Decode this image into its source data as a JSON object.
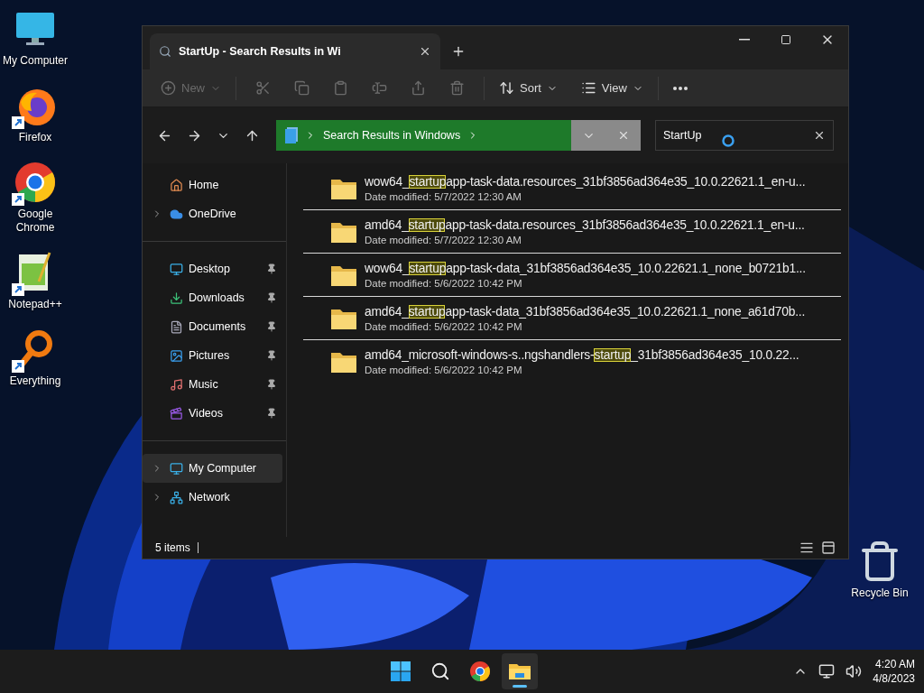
{
  "desktop_icons": [
    {
      "label": "My Computer",
      "shortcut": false
    },
    {
      "label": "Firefox",
      "shortcut": true
    },
    {
      "label": "Google Chrome",
      "shortcut": true
    },
    {
      "label": "Notepad++",
      "shortcut": true
    },
    {
      "label": "Everything",
      "shortcut": true
    }
  ],
  "recycle_bin": {
    "label": "Recycle Bin"
  },
  "window": {
    "tab": {
      "title": "StartUp - Search Results in Wi"
    },
    "toolbar": {
      "new": {
        "label": "New",
        "disabled": true
      },
      "actions": [
        {
          "disabled": true
        },
        {
          "disabled": true
        },
        {
          "disabled": true
        },
        {
          "disabled": true
        },
        {
          "disabled": true
        },
        {
          "disabled": true
        }
      ],
      "sort": {
        "label": "Sort"
      },
      "view": {
        "label": "View"
      }
    },
    "address": {
      "location": "Search Results in Windows"
    },
    "search": {
      "value": "StartUp"
    },
    "navigation": [
      {
        "items": [
          {
            "label": "Home",
            "expandable": false,
            "pinned": false,
            "selected": false
          },
          {
            "label": "OneDrive",
            "expandable": true,
            "pinned": false,
            "selected": false
          }
        ]
      },
      {
        "items": [
          {
            "label": "Desktop",
            "expandable": false,
            "pinned": true,
            "selected": false
          },
          {
            "label": "Downloads",
            "expandable": false,
            "pinned": true,
            "selected": false
          },
          {
            "label": "Documents",
            "expandable": false,
            "pinned": true,
            "selected": false
          },
          {
            "label": "Pictures",
            "expandable": false,
            "pinned": true,
            "selected": false
          },
          {
            "label": "Music",
            "expandable": false,
            "pinned": true,
            "selected": false
          },
          {
            "label": "Videos",
            "expandable": false,
            "pinned": true,
            "selected": false
          }
        ]
      },
      {
        "items": [
          {
            "label": "My Computer",
            "expandable": true,
            "pinned": false,
            "selected": true
          },
          {
            "label": "Network",
            "expandable": true,
            "pinned": false,
            "selected": false
          }
        ]
      }
    ],
    "files": [
      {
        "name": {
          "prefix": "wow64_",
          "match": "startup",
          "suffix": "app-task-data.resources_31bf3856ad364e35_10.0.22621.1_en-u..."
        },
        "modified": "Date modified: 5/7/2022 12:30 AM"
      },
      {
        "name": {
          "prefix": "amd64_",
          "match": "startup",
          "suffix": "app-task-data.resources_31bf3856ad364e35_10.0.22621.1_en-u..."
        },
        "modified": "Date modified: 5/7/2022 12:30 AM"
      },
      {
        "name": {
          "prefix": "wow64_",
          "match": "startup",
          "suffix": "app-task-data_31bf3856ad364e35_10.0.22621.1_none_b0721b1..."
        },
        "modified": "Date modified: 5/6/2022 10:42 PM"
      },
      {
        "name": {
          "prefix": "amd64_",
          "match": "startup",
          "suffix": "app-task-data_31bf3856ad364e35_10.0.22621.1_none_a61d70b..."
        },
        "modified": "Date modified: 5/6/2022 10:42 PM"
      },
      {
        "name": {
          "prefix": "amd64_microsoft-windows-s..ngshandlers-",
          "match": "startup",
          "suffix": "_31bf3856ad364e35_10.0.22..."
        },
        "modified": "Date modified: 5/6/2022 10:42 PM"
      }
    ],
    "status_bar": {
      "count": "5 items"
    }
  },
  "taskbar": {
    "apps": [
      {
        "active": false
      },
      {
        "active": false
      },
      {
        "active": false
      },
      {
        "active": true
      }
    ],
    "time": "4:20 AM",
    "date": "4/8/2023"
  }
}
